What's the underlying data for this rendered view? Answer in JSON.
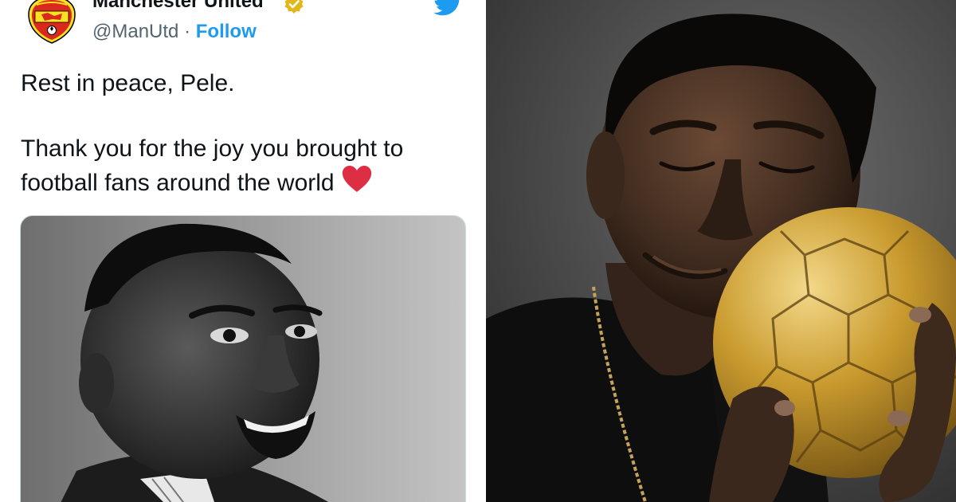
{
  "tweet": {
    "author": {
      "display_name": "Manchester United",
      "handle": "@ManUtd",
      "separator": "·",
      "follow_label": "Follow",
      "verified": true
    },
    "text": {
      "line1": "Rest in peace, Pele.",
      "line2": "Thank you for the joy you brought to football fans around the world"
    },
    "emoji": "heart-icon",
    "media": {
      "kind": "photo",
      "style": "black-and-white portrait, smiling"
    },
    "logo": "twitter-bird-icon"
  },
  "portrait": {
    "kind": "photo",
    "style": "color portrait holding golden football"
  },
  "colors": {
    "text_primary": "#0f1419",
    "text_secondary": "#536471",
    "twitter_blue": "#1d9bf0",
    "heart_red": "#e0245e",
    "verified_gold": "#e2b719",
    "club_red": "#da291c",
    "gold_ball": "#c99a2e"
  }
}
